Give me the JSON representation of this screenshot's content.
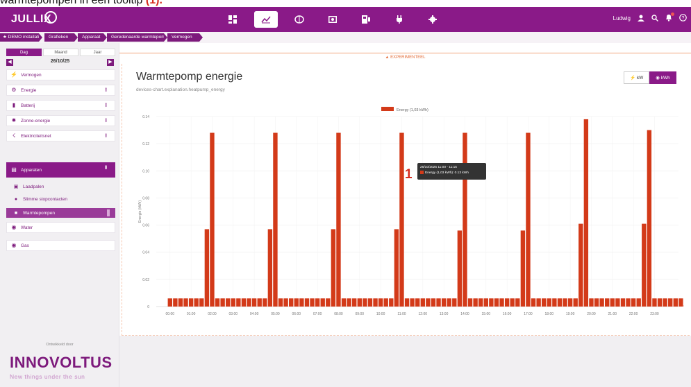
{
  "caption": {
    "text": "warmtepompen in een tooltip",
    "marker": "(1)."
  },
  "app": {
    "logo": "JULLIX",
    "nav": [
      {
        "icon": "dashboard-icon"
      },
      {
        "icon": "chart-icon",
        "active": true
      },
      {
        "icon": "brain-icon"
      },
      {
        "icon": "meter-icon"
      },
      {
        "icon": "smart-meter-icon"
      },
      {
        "icon": "plug-icon"
      },
      {
        "icon": "settings-gear-icon"
      }
    ],
    "user": {
      "name": "Ludwig"
    }
  },
  "breadcrumb": [
    "DEMO installatie",
    "Grafieken",
    "Apparaat",
    "Geredenaarde warmtepomp",
    "Vermogen"
  ],
  "sidebar": {
    "range_tabs": [
      "Dag",
      "Maand",
      "Jaar"
    ],
    "active_range": "Dag",
    "date": "26/10/25",
    "items": [
      {
        "label": "Vermogen",
        "icon": "lightning-icon",
        "dots": false
      },
      {
        "label": "Energie",
        "icon": "gear-icon",
        "dots": true
      },
      {
        "label": "Batterij",
        "icon": "battery-icon",
        "dots": true
      },
      {
        "label": "Zonne-energie",
        "icon": "sun-icon",
        "dots": true
      },
      {
        "label": "Elektriciteitsnet",
        "icon": "grid-pylon-icon",
        "dots": true
      },
      {
        "label": "Apparaten",
        "icon": "devices-icon",
        "dots": true,
        "active": true
      }
    ],
    "sub_items": [
      {
        "label": "Laadpalen",
        "icon": "charger-icon"
      },
      {
        "label": "Slimme stopcontacten",
        "icon": "plug-icon"
      },
      {
        "label": "Warmtepompen",
        "icon": "heatpump-icon",
        "active": true
      }
    ],
    "extra_items": [
      {
        "label": "Water",
        "icon": "water-icon"
      },
      {
        "label": "Gas",
        "icon": "flame-icon"
      }
    ],
    "sponsor_label": "Ontwikkeld door",
    "brand": "INNOVOLTUS",
    "brand_tagline": "New things under the sun"
  },
  "banner": {
    "text": "EXPERIMENTEEL"
  },
  "panel": {
    "title": "Warmtepomp energie",
    "subtitle": "devices-chart.explanation.heatpump_energy",
    "unit_buttons": [
      {
        "label": "kW",
        "icon": "lightning-icon",
        "active": false
      },
      {
        "label": "kWh",
        "icon": "gauge-icon",
        "active": true
      }
    ]
  },
  "tooltip": {
    "title": "26/10/2025 11:00 - 11:15",
    "line": "Energy (1,03 kWh): 0.13 kWh"
  },
  "marker": "1",
  "colors": {
    "brand": "#8a1a88",
    "bar": "#d33a19",
    "experimental": "#e3703d"
  },
  "chart_data": {
    "type": "bar",
    "legend": "Energy (1,03 kWh)",
    "ylabel": "Energie (kWh)",
    "ylim": [
      0,
      0.14
    ],
    "yticks": [
      "0",
      "0.02",
      "0.04",
      "0.06",
      "0.08",
      "0.10",
      "0.12",
      "0.14"
    ],
    "xticks": [
      "00:00",
      "01:00",
      "02:00",
      "03:00",
      "04:00",
      "05:00",
      "06:00",
      "07:00",
      "08:00",
      "09:00",
      "10:00",
      "11:00",
      "12:00",
      "13:00",
      "14:00",
      "15:00",
      "16:00",
      "17:00",
      "18:00",
      "19:00",
      "20:00",
      "21:00",
      "22:00",
      "23:00"
    ],
    "interval_minutes": 15,
    "values": [
      0.006,
      0.006,
      0.006,
      0.006,
      0.006,
      0.006,
      0.006,
      0.057,
      0.128,
      0.006,
      0.006,
      0.006,
      0.006,
      0.006,
      0.006,
      0.006,
      0.006,
      0.006,
      0.006,
      0.057,
      0.128,
      0.006,
      0.006,
      0.006,
      0.006,
      0.006,
      0.006,
      0.006,
      0.006,
      0.006,
      0.006,
      0.057,
      0.128,
      0.006,
      0.006,
      0.006,
      0.006,
      0.006,
      0.006,
      0.006,
      0.006,
      0.006,
      0.006,
      0.057,
      0.128,
      0.006,
      0.006,
      0.006,
      0.006,
      0.006,
      0.006,
      0.006,
      0.006,
      0.006,
      0.006,
      0.056,
      0.128,
      0.006,
      0.006,
      0.006,
      0.006,
      0.006,
      0.006,
      0.006,
      0.006,
      0.006,
      0.006,
      0.056,
      0.128,
      0.006,
      0.006,
      0.006,
      0.006,
      0.006,
      0.006,
      0.006,
      0.006,
      0.006,
      0.061,
      0.138,
      0.006,
      0.006,
      0.006,
      0.006,
      0.006,
      0.006,
      0.006,
      0.006,
      0.006,
      0.006,
      0.061,
      0.13,
      0.006,
      0.006,
      0.006,
      0.006,
      0.006,
      0.006,
      0.001
    ],
    "grid": true,
    "legend_position": "top-center"
  }
}
